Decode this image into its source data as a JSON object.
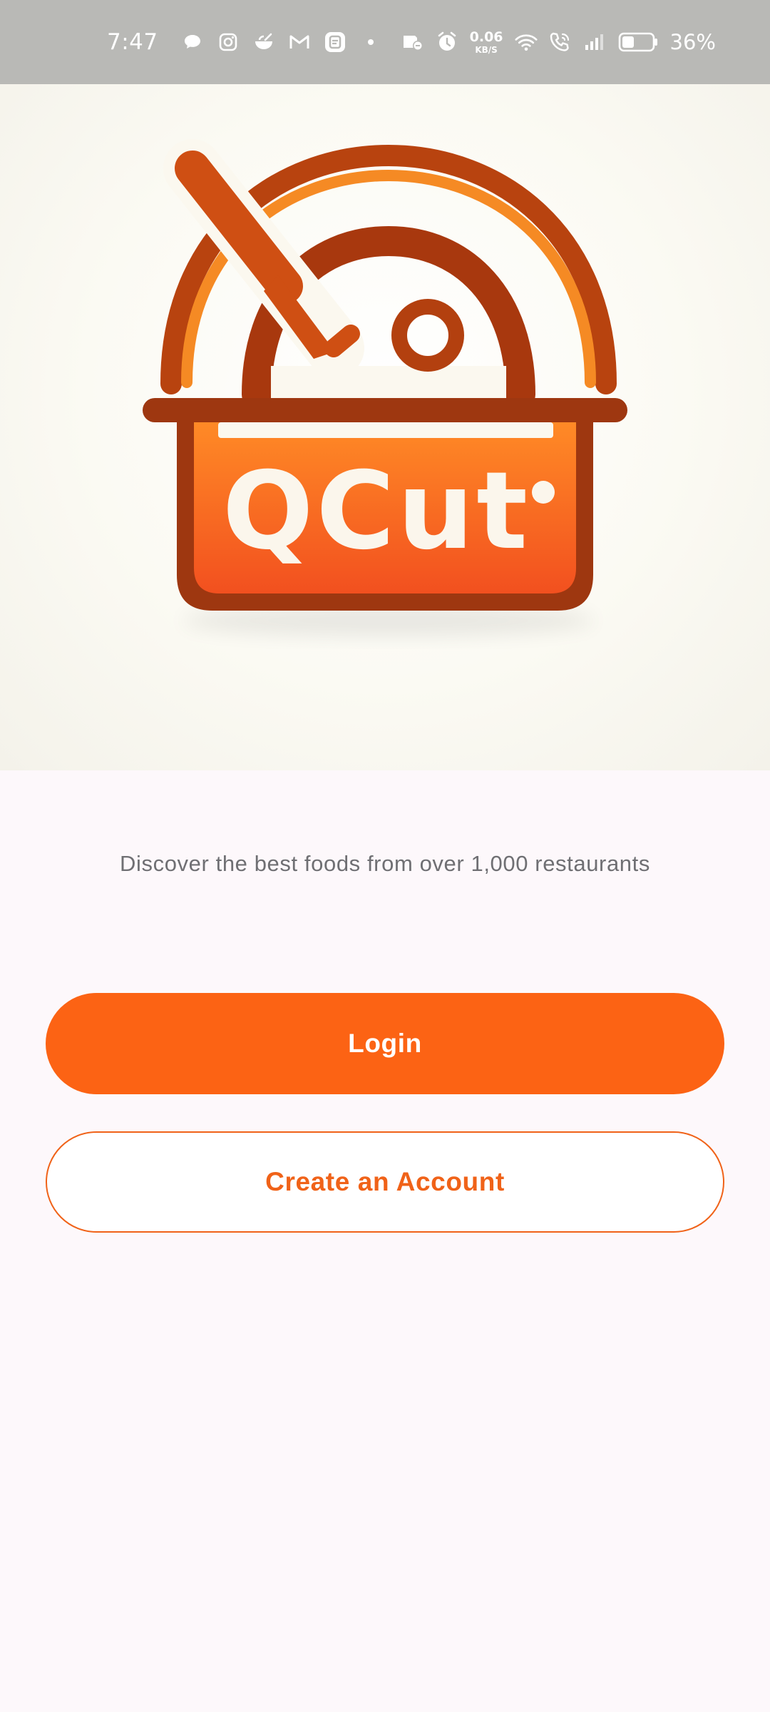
{
  "status_bar": {
    "time": "7:47",
    "net_speed_value": "0.06",
    "net_speed_unit": "KB/S",
    "battery_percent": "36%",
    "notification_icons": [
      "chat-bubble-icon",
      "instagram-icon",
      "bowl-icon",
      "gmail-icon",
      "app-notification-icon",
      "dot-icon"
    ],
    "system_icons": [
      "do-not-disturb-icon",
      "alarm-icon",
      "wifi-icon",
      "wifi-calling-icon",
      "signal-icon",
      "battery-icon"
    ]
  },
  "logo": {
    "text": "QCut",
    "icon": "pot-with-knife-logo",
    "colors": {
      "orange": "#fc6314",
      "dark_brown": "#9a3410",
      "cream": "#fbf8ef"
    }
  },
  "tagline": "Discover the best foods from over 1,000 restaurants",
  "buttons": {
    "login": "Login",
    "create_account": "Create an Account"
  },
  "colors": {
    "accent": "#fc6314",
    "background": "#fdf8fb",
    "text_muted": "#6f6f73"
  }
}
